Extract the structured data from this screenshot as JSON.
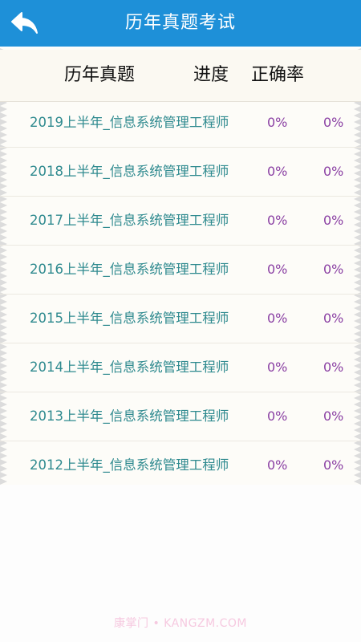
{
  "app_bar": {
    "title": "历年真题考试",
    "back_icon": "back-arrow-icon",
    "color": "#1e90d8"
  },
  "table": {
    "headers": {
      "title": "历年真题",
      "progress": "进度",
      "accuracy": "正确率"
    },
    "rows": [
      {
        "name": "2019上半年_信息系统管理工程师",
        "progress": "0%",
        "accuracy": "0%"
      },
      {
        "name": "2018上半年_信息系统管理工程师",
        "progress": "0%",
        "accuracy": "0%"
      },
      {
        "name": "2017上半年_信息系统管理工程师",
        "progress": "0%",
        "accuracy": "0%"
      },
      {
        "name": "2016上半年_信息系统管理工程师",
        "progress": "0%",
        "accuracy": "0%"
      },
      {
        "name": "2015上半年_信息系统管理工程师",
        "progress": "0%",
        "accuracy": "0%"
      },
      {
        "name": "2014上半年_信息系统管理工程师",
        "progress": "0%",
        "accuracy": "0%"
      },
      {
        "name": "2013上半年_信息系统管理工程师",
        "progress": "0%",
        "accuracy": "0%"
      },
      {
        "name": "2012上半年_信息系统管理工程师",
        "progress": "0%",
        "accuracy": "0%"
      }
    ],
    "name_color": "#2f8a8f",
    "value_color": "#8a3fa3"
  },
  "watermark": "康掌门 • KANGZM.COM"
}
